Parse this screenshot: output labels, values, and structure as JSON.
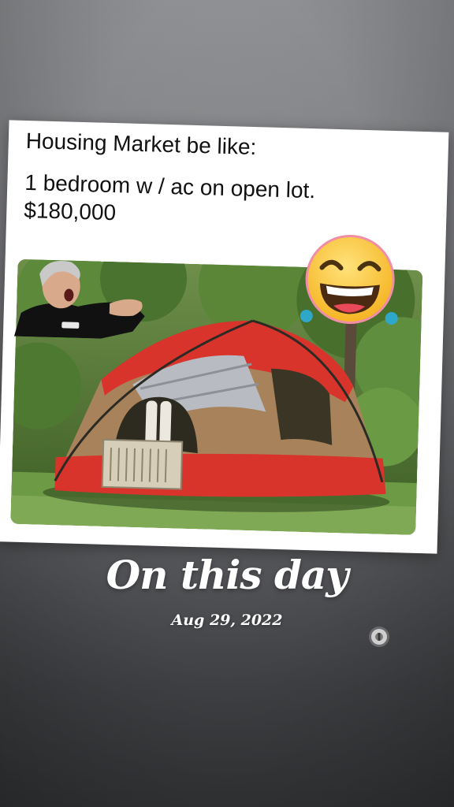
{
  "meme": {
    "caption_line1": "Housing Market be like:",
    "caption_line2": "1 bedroom w / ac on open lot.",
    "caption_line3": "$180,000"
  },
  "memory": {
    "title": "On this day",
    "date": "Aug 29, 2022"
  },
  "colors": {
    "tent_red": "#d8342c",
    "tent_tan": "#a8825a",
    "foliage": "#4f7a32",
    "emoji_face": "#f7c323"
  },
  "icons": {
    "emoji": "laughing-tears-emoji",
    "reaction_sticker": "shocked-man-sticker",
    "door_knob": "door-lock-knob"
  }
}
